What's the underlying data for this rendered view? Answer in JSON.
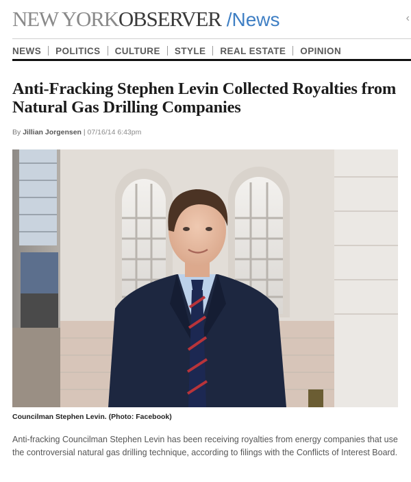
{
  "masthead": {
    "logo_part1": "NEW YORK",
    "logo_part2": "OBSERVER",
    "section": "/News"
  },
  "nav": {
    "items": [
      "NEWS",
      "POLITICS",
      "CULTURE",
      "STYLE",
      "REAL ESTATE",
      "OPINION"
    ]
  },
  "article": {
    "headline": "Anti-Fracking Stephen Levin Collected Royalties from Natural Gas Drilling Companies",
    "byline_prefix": "By",
    "author": "Jillian Jorgensen",
    "byline_separator": "|",
    "date": "07/16/14 6:43pm",
    "photo_caption": "Councilman Stephen Levin. (Photo: Facebook)",
    "lede": "Anti-fracking Councilman Stephen Levin has been receiving royalties from energy companies that use the controversial natural gas drilling technique, according to filings with the Conflicts of Interest Board."
  },
  "colors": {
    "accent": "#3f7fc4",
    "nav_text": "#5a5a5a",
    "rule": "#111111"
  }
}
